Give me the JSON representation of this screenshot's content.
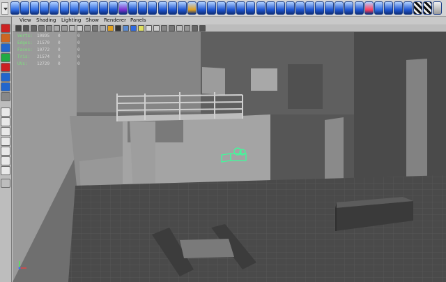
{
  "menu": {
    "items": [
      "View",
      "Shading",
      "Lighting",
      "Show",
      "Renderer",
      "Panels"
    ]
  },
  "hud": {
    "rows": [
      {
        "label": "Verts:",
        "v1": "10895",
        "v2": "0",
        "v3": "0"
      },
      {
        "label": "Edges:",
        "v1": "21570",
        "v2": "0",
        "v3": "0"
      },
      {
        "label": "Faces:",
        "v1": "10772",
        "v2": "0",
        "v3": "0"
      },
      {
        "label": "Tris:",
        "v1": "21574",
        "v2": "0",
        "v3": "0"
      },
      {
        "label": "UVs:",
        "v1": "12729",
        "v2": "0",
        "v3": "0"
      }
    ]
  },
  "colors": {
    "shelf_icon_primary": "#1f55d0",
    "viewport_background": "#6b6b6b",
    "hud_label": "#7de07d",
    "camera_object": "#3cff9a"
  },
  "icons": {
    "shelf": [
      "polygon-cube-icon",
      "polygon-sphere-icon",
      "polygon-cylinder-icon",
      "polygon-cone-icon",
      "polygon-plane-icon",
      "polygon-torus-icon",
      "polygon-prism-icon",
      "polygon-pipe-icon",
      "polygon-helix-icon",
      "polygon-soccer-icon",
      "combine-icon",
      "separate-icon",
      "extract-icon",
      "smooth-icon",
      "boolean-union-icon",
      "boolean-difference-icon",
      "boolean-intersection-icon",
      "mirror-icon",
      "fill-hole-icon",
      "triangulate-icon",
      "quadrangulate-icon",
      "extrude-face-icon",
      "extrude-edge-icon",
      "bridge-icon",
      "append-icon",
      "split-icon",
      "insert-edge-loop-icon",
      "merge-icon",
      "collapse-icon",
      "delete-edge-icon",
      "chamfer-icon",
      "bevel-icon",
      "poke-icon",
      "wedge-icon",
      "duplicate-face-icon",
      "crease-icon",
      "uv-editor-icon",
      "planar-map-icon",
      "cylindrical-map-icon",
      "spherical-map-icon",
      "auto-map-icon",
      "checker-icon",
      "checker-alt-icon",
      "render-view-icon"
    ],
    "toolbox": [
      "select-icon",
      "lasso-icon",
      "move-icon",
      "rotate-icon",
      "scale-icon",
      "soft-mod-icon",
      "show-manipulator-icon",
      "last-tool-icon",
      "single-perspective-layout-icon",
      "four-view-layout-icon",
      "persp-outliner-layout-icon",
      "persp-graph-layout-icon",
      "hypershade-layout-icon",
      "render-view-layout-icon",
      "outliner-icon",
      "expand-arrow-icon"
    ],
    "panel": [
      "select-camera-icon",
      "camera-attributes-icon",
      "bookmarks-icon",
      "image-plane-icon",
      "grid-icon",
      "film-gate-icon",
      "resolution-gate-icon",
      "gate-mask-icon",
      "field-chart-icon",
      "safe-action-icon",
      "safe-title-icon",
      "wireframe-icon",
      "smooth-shade-icon",
      "wireframe-on-shaded-icon",
      "textured-icon",
      "use-lights-icon",
      "shadows-icon",
      "isolate-select-icon",
      "xray-icon",
      "xray-joints-icon",
      "xray-components-icon",
      "default-quality-icon",
      "high-quality-icon",
      "backface-culling-icon",
      "smooth-wireframe-icon"
    ]
  }
}
